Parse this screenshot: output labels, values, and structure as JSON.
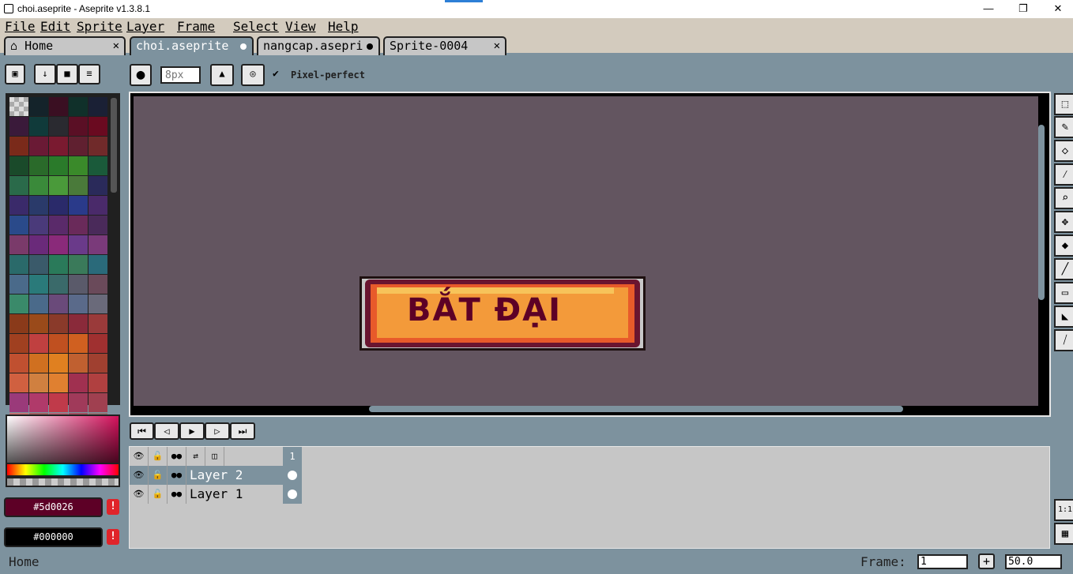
{
  "window": {
    "title": "choi.aseprite - Aseprite v1.3.8.1",
    "minimize": "—",
    "maximize": "❐",
    "close": "✕"
  },
  "menus": [
    "File",
    "Edit",
    "Sprite",
    "Layer",
    "Frame",
    "Select",
    "View",
    "Help"
  ],
  "tabs": [
    {
      "label": "Home",
      "marker": "✕"
    },
    {
      "label": "choi.aseprite"
    },
    {
      "label": "nangcap.asepri"
    },
    {
      "label": "Sprite-0004",
      "marker": "✕"
    }
  ],
  "toolbar": {
    "brush_size_placeholder": "8px",
    "pixel_perfect_label": "Pixel-perfect",
    "checkmark": "✔"
  },
  "sprite": {
    "text": "BẮT ĐẠI"
  },
  "colors": {
    "foreground_hex": "#5d0026",
    "background_hex": "#000000",
    "warning_icon": "!",
    "palette": [
      "#a0a0a0",
      "#14232a",
      "#3a0f22",
      "#10302a",
      "#1a2035",
      "#3a1a3a",
      "#103a3a",
      "#2a2a30",
      "#5a0f25",
      "#6a0a20",
      "#7a2a1a",
      "#6a1a35",
      "#7a1a30",
      "#602030",
      "#702a2a",
      "#1a4a2a",
      "#2a6a2a",
      "#2a7a2a",
      "#3a8a2a",
      "#1a5a3a",
      "#2a6a4a",
      "#3a8a3a",
      "#4a9a3a",
      "#4a7a3a",
      "#2a2a5a",
      "#3a2a6a",
      "#2a3a6a",
      "#2a2a6a",
      "#2a3a8a",
      "#4a2a6a",
      "#2a4a8a",
      "#4a3a7a",
      "#5a2a6a",
      "#6a2a5a",
      "#4a2a5a",
      "#7a3a6a",
      "#6a2a7a",
      "#8a2a7a",
      "#6a3a8a",
      "#7a3a7a",
      "#2a6a6a",
      "#3a5a6a",
      "#2a7a5a",
      "#3a7a5a",
      "#2a6a7a",
      "#4a6a8a",
      "#2a7a7a",
      "#3a6a6a",
      "#5a5a6a",
      "#6a4a5a",
      "#3a8a6a",
      "#4a6a8a",
      "#6a4a7a",
      "#5a6a8a",
      "#6a6a7a",
      "#8a3a1a",
      "#9a4a1a",
      "#8a3a2a",
      "#8a2a3a",
      "#9a3a3a",
      "#a04020",
      "#c04040",
      "#c05020",
      "#d06020",
      "#a03030",
      "#c05030",
      "#d07020",
      "#e08020",
      "#c06030",
      "#a04030",
      "#d06040",
      "#d08040",
      "#e08030",
      "#a03050",
      "#b04040",
      "#9a3a7a",
      "#b03a6a",
      "#c03a4a",
      "#a03a5a",
      "#a04050",
      "#c07070",
      "#a06060",
      "#b06070",
      "#a05060",
      "#907070"
    ]
  },
  "playback": {
    "first": "⏮",
    "prev": "◁",
    "play": "▶",
    "next": "▷",
    "last": "⏭"
  },
  "timeline": {
    "header": {
      "eye": "👁",
      "lock": "🔓",
      "continuous": "●●",
      "link": "⇄",
      "onion": "◫"
    },
    "frame_number": "1",
    "layers": [
      {
        "name": "Layer 2",
        "selected": true
      },
      {
        "name": "Layer 1",
        "selected": false
      }
    ]
  },
  "zoom_buttons": {
    "one_to_one": "1:1",
    "grid": "▦"
  },
  "status": {
    "left_text": "Home",
    "frame_label": "Frame:",
    "frame_value": "1",
    "add": "+",
    "zoom_value": "50.0"
  }
}
